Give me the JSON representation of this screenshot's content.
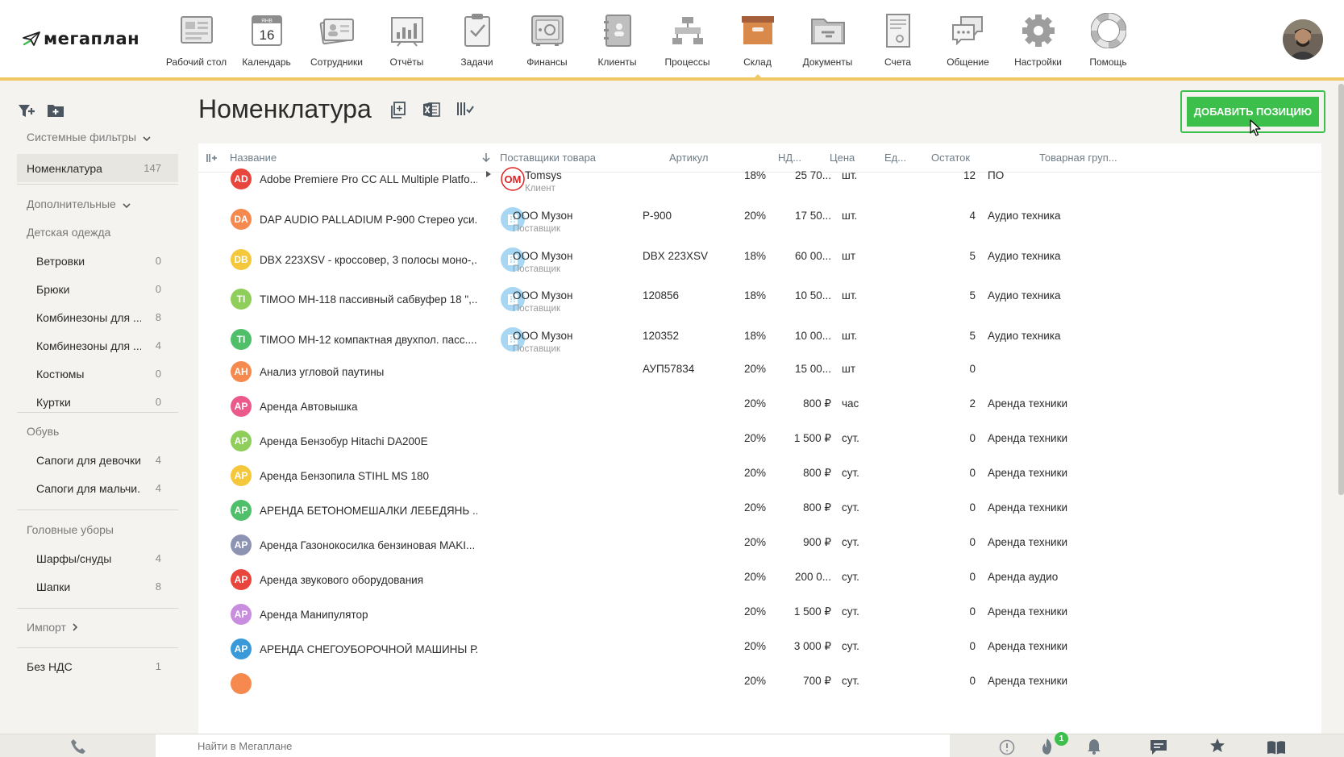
{
  "brand": {
    "name": "мегаплан"
  },
  "nav": [
    {
      "label": "Рабочий стол",
      "icon": "desktop-icon"
    },
    {
      "label": "Календарь",
      "icon": "calendar-icon",
      "day": "16",
      "month": "ЯНВ"
    },
    {
      "label": "Сотрудники",
      "icon": "employees-icon"
    },
    {
      "label": "Отчёты",
      "icon": "reports-icon"
    },
    {
      "label": "Задачи",
      "icon": "tasks-icon"
    },
    {
      "label": "Финансы",
      "icon": "safe-icon"
    },
    {
      "label": "Клиенты",
      "icon": "clients-icon"
    },
    {
      "label": "Процессы",
      "icon": "processes-icon"
    },
    {
      "label": "Склад",
      "icon": "warehouse-icon",
      "active": true
    },
    {
      "label": "Документы",
      "icon": "documents-icon"
    },
    {
      "label": "Счета",
      "icon": "invoices-icon"
    },
    {
      "label": "Общение",
      "icon": "chat-icon"
    },
    {
      "label": "Настройки",
      "icon": "settings-icon"
    },
    {
      "label": "Помощь",
      "icon": "help-icon"
    }
  ],
  "sidebar": {
    "system_filters": "Системные фильтры",
    "nomenclature": {
      "label": "Номенклатура",
      "count": "147"
    },
    "additional": "Дополнительные",
    "kids_clothes": {
      "title": "Детская одежда",
      "items": [
        {
          "label": "Ветровки",
          "count": "0"
        },
        {
          "label": "Брюки",
          "count": "0"
        },
        {
          "label": "Комбинезоны для ...",
          "count": "8"
        },
        {
          "label": "Комбинезоны для ...",
          "count": "4"
        },
        {
          "label": "Костюмы",
          "count": "0"
        },
        {
          "label": "Куртки",
          "count": "0"
        }
      ]
    },
    "shoes": {
      "title": "Обувь",
      "items": [
        {
          "label": "Сапоги для девочки",
          "count": "4"
        },
        {
          "label": "Сапоги для мальчи...",
          "count": "4"
        }
      ]
    },
    "hats": {
      "title": "Головные уборы",
      "items": [
        {
          "label": "Шарфы/снуды",
          "count": "4"
        },
        {
          "label": "Шапки",
          "count": "8"
        }
      ]
    },
    "import": "Импорт",
    "no_vat": {
      "label": "Без НДС",
      "count": "1"
    }
  },
  "main": {
    "title": "Номенклатура",
    "add_button": "ДОБАВИТЬ ПОЗИЦИЮ"
  },
  "table": {
    "columns": {
      "name": "Название",
      "supplier": "Поставщики товара",
      "sku": "Артикул",
      "vat": "НД...",
      "price": "Цена",
      "unit": "Ед...",
      "stock": "Остаток",
      "group": "Товарная груп..."
    },
    "rows": [
      {
        "initials": "AD",
        "color": "#e8453c",
        "name": "Adobe Premiere Pro CC ALL Multiple Platfo...",
        "supplier": "Tomsys",
        "supplier_role": "Клиент",
        "supplier_logo": "OM",
        "sku": "",
        "vat": "18%",
        "price": "25 70...",
        "unit": "шт.",
        "stock": "12",
        "group": "ПО"
      },
      {
        "initials": "DA",
        "color": "#f5894e",
        "name": "DAP AUDIO PALLADIUM P-900 Стерео уси...",
        "supplier": "ООО Музон",
        "supplier_role": "Поставщик",
        "sku": "P-900",
        "vat": "20%",
        "price": "17 50...",
        "unit": "шт.",
        "stock": "4",
        "group": "Аудио техника"
      },
      {
        "initials": "DB",
        "color": "#f5c83c",
        "name": "DBX 223XSV - кроссовер, 3 полосы моно-,...",
        "supplier": "ООО Музон",
        "supplier_role": "Поставщик",
        "sku": "DBX 223XSV",
        "vat": "18%",
        "price": "60 00...",
        "unit": "шт",
        "stock": "5",
        "group": "Аудио техника"
      },
      {
        "initials": "TI",
        "color": "#8fce5a",
        "name": "TIMOO MH-118 пассивный сабвуфер 18 \",...",
        "supplier": "ООО Музон",
        "supplier_role": "Поставщик",
        "sku": "120856",
        "vat": "18%",
        "price": "10 50...",
        "unit": "шт.",
        "stock": "5",
        "group": "Аудио техника"
      },
      {
        "initials": "TI",
        "color": "#4fbf6a",
        "name": "TIMOO MH-12 компактная двухпол. пасс....",
        "supplier": "ООО Музон",
        "supplier_role": "Поставщик",
        "sku": "120352",
        "vat": "18%",
        "price": "10 00...",
        "unit": "шт.",
        "stock": "5",
        "group": "Аудио техника"
      },
      {
        "initials": "АН",
        "color": "#f5894e",
        "name": "Анализ угловой паутины",
        "supplier": "",
        "supplier_role": "",
        "sku": "АУП57834",
        "vat": "20%",
        "price": "15 00...",
        "unit": "шт",
        "stock": "0",
        "group": ""
      },
      {
        "initials": "АР",
        "color": "#ec5a8c",
        "name": "Аренда Автовышка",
        "supplier": "",
        "supplier_role": "",
        "sku": "",
        "vat": "20%",
        "price": "800 ₽",
        "unit": "час",
        "stock": "2",
        "group": "Аренда техники"
      },
      {
        "initials": "АР",
        "color": "#8fce5a",
        "name": "Аренда Бензобур Hitachi DA200E",
        "supplier": "",
        "supplier_role": "",
        "sku": "",
        "vat": "20%",
        "price": "1 500 ₽",
        "unit": "сут.",
        "stock": "0",
        "group": "Аренда техники"
      },
      {
        "initials": "АР",
        "color": "#f5c83c",
        "name": "Аренда Бензопила STIHL MS 180",
        "supplier": "",
        "supplier_role": "",
        "sku": "",
        "vat": "20%",
        "price": "800 ₽",
        "unit": "сут.",
        "stock": "0",
        "group": "Аренда техники"
      },
      {
        "initials": "АР",
        "color": "#4fbf6a",
        "name": "АРЕНДА БЕТОНОМЕШАЛКИ ЛЕБЕДЯНЬ ...",
        "supplier": "",
        "supplier_role": "",
        "sku": "",
        "vat": "20%",
        "price": "800 ₽",
        "unit": "сут.",
        "stock": "0",
        "group": "Аренда техники"
      },
      {
        "initials": "АР",
        "color": "#8d93b3",
        "name": "Аренда Газонокосилка бензиновая MAKI...",
        "supplier": "",
        "supplier_role": "",
        "sku": "",
        "vat": "20%",
        "price": "900 ₽",
        "unit": "сут.",
        "stock": "0",
        "group": "Аренда техники"
      },
      {
        "initials": "АР",
        "color": "#e8453c",
        "name": "Аренда звукового оборудования",
        "supplier": "",
        "supplier_role": "",
        "sku": "",
        "vat": "20%",
        "price": "200 0...",
        "unit": "сут.",
        "stock": "0",
        "group": "Аренда аудио"
      },
      {
        "initials": "АР",
        "color": "#c98de0",
        "name": "Аренда Манипулятор",
        "supplier": "",
        "supplier_role": "",
        "sku": "",
        "vat": "20%",
        "price": "1 500 ₽",
        "unit": "сут.",
        "stock": "0",
        "group": "Аренда техники"
      },
      {
        "initials": "АР",
        "color": "#3a9ad9",
        "name": "АРЕНДА СНЕГОУБОРОЧНОЙ МАШИНЫ Р...",
        "supplier": "",
        "supplier_role": "",
        "sku": "",
        "vat": "20%",
        "price": "3 000 ₽",
        "unit": "сут.",
        "stock": "0",
        "group": "Аренда техники"
      },
      {
        "initials": "",
        "color": "#f5894e",
        "name": "",
        "supplier": "",
        "supplier_role": "",
        "sku": "",
        "vat": "20%",
        "price": "700 ₽",
        "unit": "сут.",
        "stock": "0",
        "group": "Аренда техники"
      }
    ]
  },
  "bottombar": {
    "search_placeholder": "Найти в Мегаплане",
    "notifications_count": "1"
  },
  "colors": {
    "accent_yellow": "#f0c965",
    "primary_green": "#3cbf4b",
    "supplier_blue": "#a7d7f2"
  }
}
